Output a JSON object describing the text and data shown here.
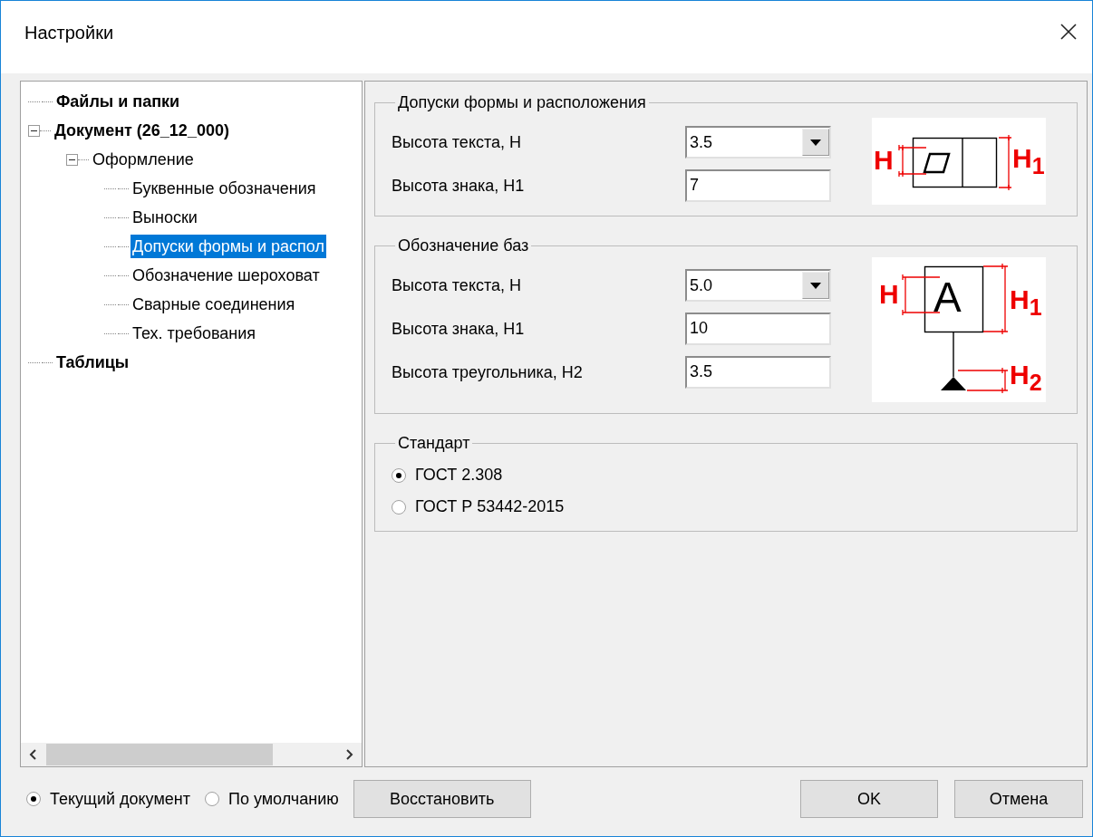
{
  "window": {
    "title": "Настройки"
  },
  "tree": [
    {
      "label": "Файлы и папки",
      "selected": false
    },
    {
      "label": "Документ (26_12_000)",
      "selected": false,
      "expanded": true,
      "children": [
        {
          "label": "Оформление",
          "selected": false,
          "expanded": true,
          "children": [
            {
              "label": "Буквенные обозначения",
              "selected": false
            },
            {
              "label": "Выноски",
              "selected": false
            },
            {
              "label": "Допуски формы и распол",
              "selected": true
            },
            {
              "label": "Обозначение шероховат",
              "selected": false
            },
            {
              "label": "Сварные соединения",
              "selected": false
            },
            {
              "label": "Тех. требования",
              "selected": false
            }
          ]
        }
      ]
    },
    {
      "label": "Таблицы",
      "selected": false
    }
  ],
  "groups": [
    {
      "title": "Допуски формы и расположения",
      "fields": [
        {
          "kind": "dropdown",
          "label": "Высота текста,  H",
          "value": "3.5"
        },
        {
          "kind": "text",
          "label": "Высота знака,  H1",
          "value": "7"
        }
      ],
      "diagram": {
        "kind": "tolerance",
        "labels": [
          "H",
          "H$_{1}$"
        ]
      }
    },
    {
      "title": "Обозначение баз",
      "fields": [
        {
          "kind": "dropdown",
          "label": "Высота текста,  H",
          "value": "5.0"
        },
        {
          "kind": "text",
          "label": "Высота знака,  H1",
          "value": "10"
        },
        {
          "kind": "text",
          "label": "Высота треугольника, H2",
          "value": "3.5"
        }
      ],
      "diagram": {
        "kind": "datum",
        "letter": "A",
        "labels": [
          "H",
          "H$_{1}$",
          "H$_{2}$"
        ]
      }
    }
  ],
  "standard": {
    "title": "Стандарт",
    "options": [
      {
        "label": "ГОСТ 2.308",
        "selected": true
      },
      {
        "label": "ГОСТ Р 53442-2015",
        "selected": false
      }
    ]
  },
  "footer": {
    "scope": [
      {
        "label": "Текущий документ",
        "selected": true
      },
      {
        "label": "По умолчанию",
        "selected": false
      }
    ],
    "restore": "Восстановить",
    "ok": "OK",
    "cancel": "Отмена"
  }
}
